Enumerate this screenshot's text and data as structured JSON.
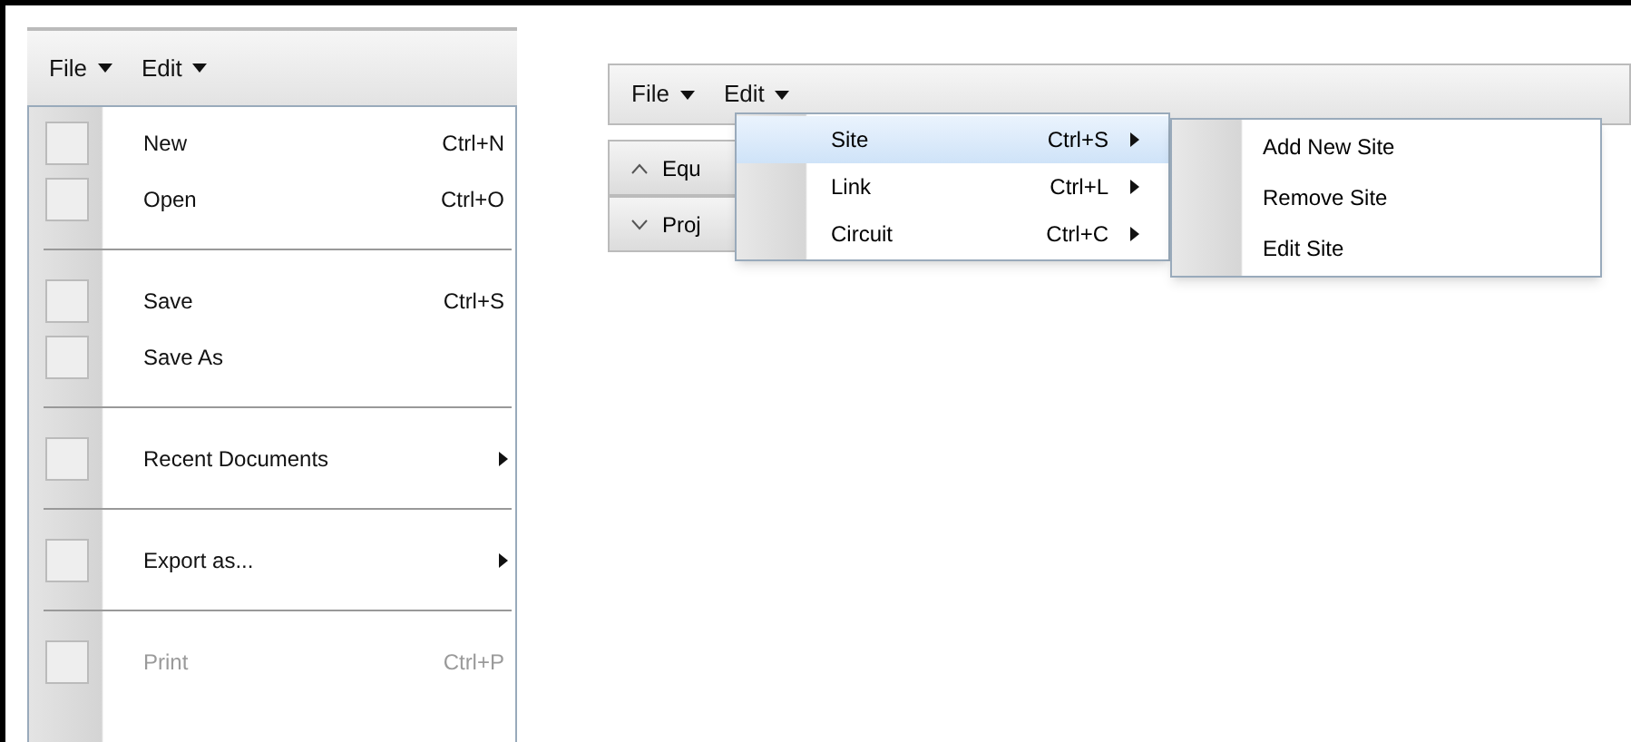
{
  "left_panel": {
    "menubar": [
      {
        "label": "File"
      },
      {
        "label": "Edit"
      }
    ],
    "file_menu": [
      {
        "kind": "item",
        "label": "New",
        "shortcut": "Ctrl+N",
        "disabled": false,
        "submenu": false
      },
      {
        "kind": "item",
        "label": "Open",
        "shortcut": "Ctrl+O",
        "disabled": false,
        "submenu": false
      },
      {
        "kind": "separator"
      },
      {
        "kind": "item",
        "label": "Save",
        "shortcut": "Ctrl+S",
        "disabled": false,
        "submenu": false
      },
      {
        "kind": "item",
        "label": "Save As",
        "disabled": false,
        "submenu": false
      },
      {
        "kind": "separator"
      },
      {
        "kind": "item",
        "label": "Recent Documents",
        "disabled": false,
        "submenu": true
      },
      {
        "kind": "separator"
      },
      {
        "kind": "item",
        "label": "Export as...",
        "disabled": false,
        "submenu": true
      },
      {
        "kind": "separator"
      },
      {
        "kind": "item",
        "label": "Print",
        "shortcut": "Ctrl+P",
        "disabled": true,
        "submenu": false
      }
    ]
  },
  "right_panel": {
    "menubar": [
      {
        "label": "File"
      },
      {
        "label": "Edit"
      }
    ],
    "accordion": [
      {
        "label": "Equ",
        "expanded": true
      },
      {
        "label": "Proj",
        "expanded": false
      }
    ],
    "edit_menu": [
      {
        "label": "Site",
        "shortcut": "Ctrl+S",
        "selected": true
      },
      {
        "label": "Link",
        "shortcut": "Ctrl+L",
        "selected": false
      },
      {
        "label": "Circuit",
        "shortcut": "Ctrl+C",
        "selected": false
      }
    ],
    "site_submenu": [
      {
        "label": "Add New Site"
      },
      {
        "label": "Remove Site"
      },
      {
        "label": "Edit Site"
      }
    ]
  }
}
